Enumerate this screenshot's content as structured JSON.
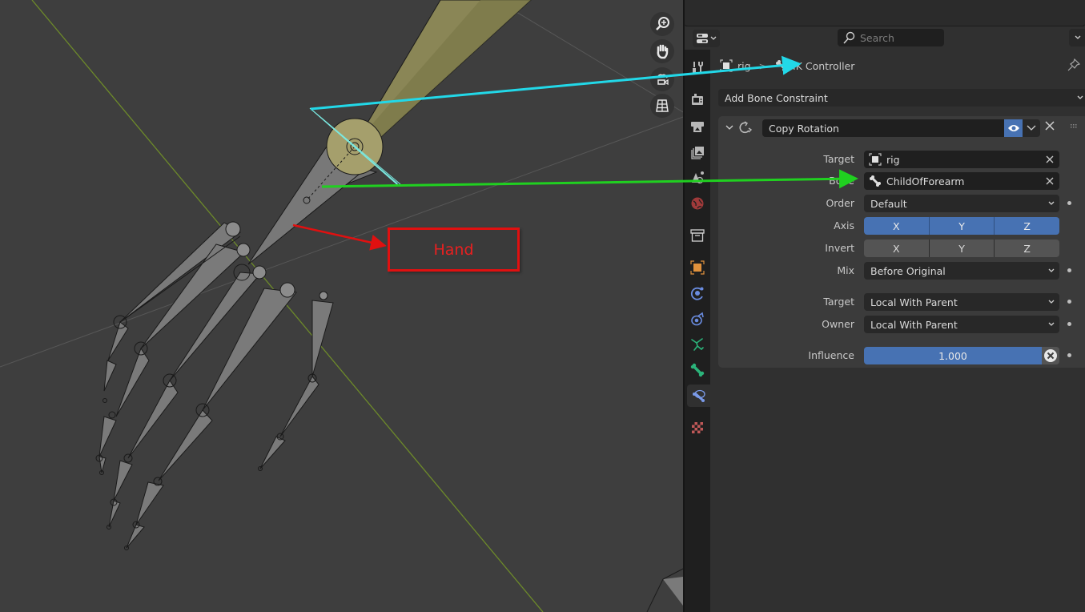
{
  "viewport": {
    "annotation_box": {
      "label": "Hand",
      "color": "#e01010"
    },
    "nav_gizmo": [
      {
        "name": "zoom",
        "icon": "zoom-icon"
      },
      {
        "name": "pan",
        "icon": "hand-icon"
      },
      {
        "name": "camera-view",
        "icon": "camera-icon"
      },
      {
        "name": "perspective-toggle",
        "icon": "grid-icon"
      }
    ],
    "annotation_arrows": [
      {
        "color": "#22d8e8",
        "points_to": "IK Controller"
      },
      {
        "color": "#20d020",
        "points_to": "Bone field"
      },
      {
        "color": "#e01010",
        "points_to": "Hand"
      }
    ]
  },
  "properties": {
    "search": {
      "placeholder": "Search"
    },
    "breadcrumb": {
      "object": "rig",
      "separator": ">",
      "bone": "IK Controller"
    },
    "add_constraint_label": "Add Bone Constraint",
    "tabs": [
      {
        "name": "tool",
        "icon": "tool-icon",
        "color": "#b8b8b8"
      },
      {
        "name": "render",
        "icon": "render-icon",
        "color": "#b8b8b8"
      },
      {
        "name": "output",
        "icon": "output-icon",
        "color": "#b8b8b8"
      },
      {
        "name": "view-layer",
        "icon": "view-layer-icon",
        "color": "#b8b8b8"
      },
      {
        "name": "scene",
        "icon": "scene-icon",
        "color": "#b8b8b8"
      },
      {
        "name": "world",
        "icon": "world-icon",
        "color": "#c04a4a"
      },
      {
        "name": "collection",
        "icon": "collection-icon",
        "color": "#d0d0d0"
      },
      {
        "name": "object",
        "icon": "object-icon",
        "color": "#e0913c"
      },
      {
        "name": "modifiers",
        "icon": "modifier-icon",
        "color": "#6a8ce0"
      },
      {
        "name": "physics",
        "icon": "physics-icon",
        "color": "#6a8ce0"
      },
      {
        "name": "object-data",
        "icon": "armature-icon",
        "color": "#2bb37a"
      },
      {
        "name": "bone",
        "icon": "bone-icon",
        "color": "#2bb37a"
      },
      {
        "name": "bone-constraints",
        "icon": "bone-constraint-icon",
        "color": "#6a8ce0",
        "active": true
      },
      {
        "name": "texture",
        "icon": "texture-icon",
        "color": "#c05858"
      }
    ],
    "constraint": {
      "name": "Copy Rotation",
      "enabled": true,
      "target_label": "Target",
      "target_value": "rig",
      "bone_label": "Bone",
      "bone_value": "ChildOfForearm",
      "order_label": "Order",
      "order_value": "Default",
      "axis_label": "Axis",
      "axis": [
        {
          "label": "X",
          "on": true
        },
        {
          "label": "Y",
          "on": true
        },
        {
          "label": "Z",
          "on": true
        }
      ],
      "invert_label": "Invert",
      "invert": [
        {
          "label": "X",
          "on": false
        },
        {
          "label": "Y",
          "on": false
        },
        {
          "label": "Z",
          "on": false
        }
      ],
      "mix_label": "Mix",
      "mix_value": "Before Original",
      "target_space_label": "Target",
      "target_space_value": "Local With Parent",
      "owner_space_label": "Owner",
      "owner_space_value": "Local With Parent",
      "influence_label": "Influence",
      "influence_value": "1.000"
    }
  },
  "colors": {
    "accent_blue": "#4772b3",
    "viewport_bg": "#3e3e3e",
    "panel_bg": "#303030"
  }
}
